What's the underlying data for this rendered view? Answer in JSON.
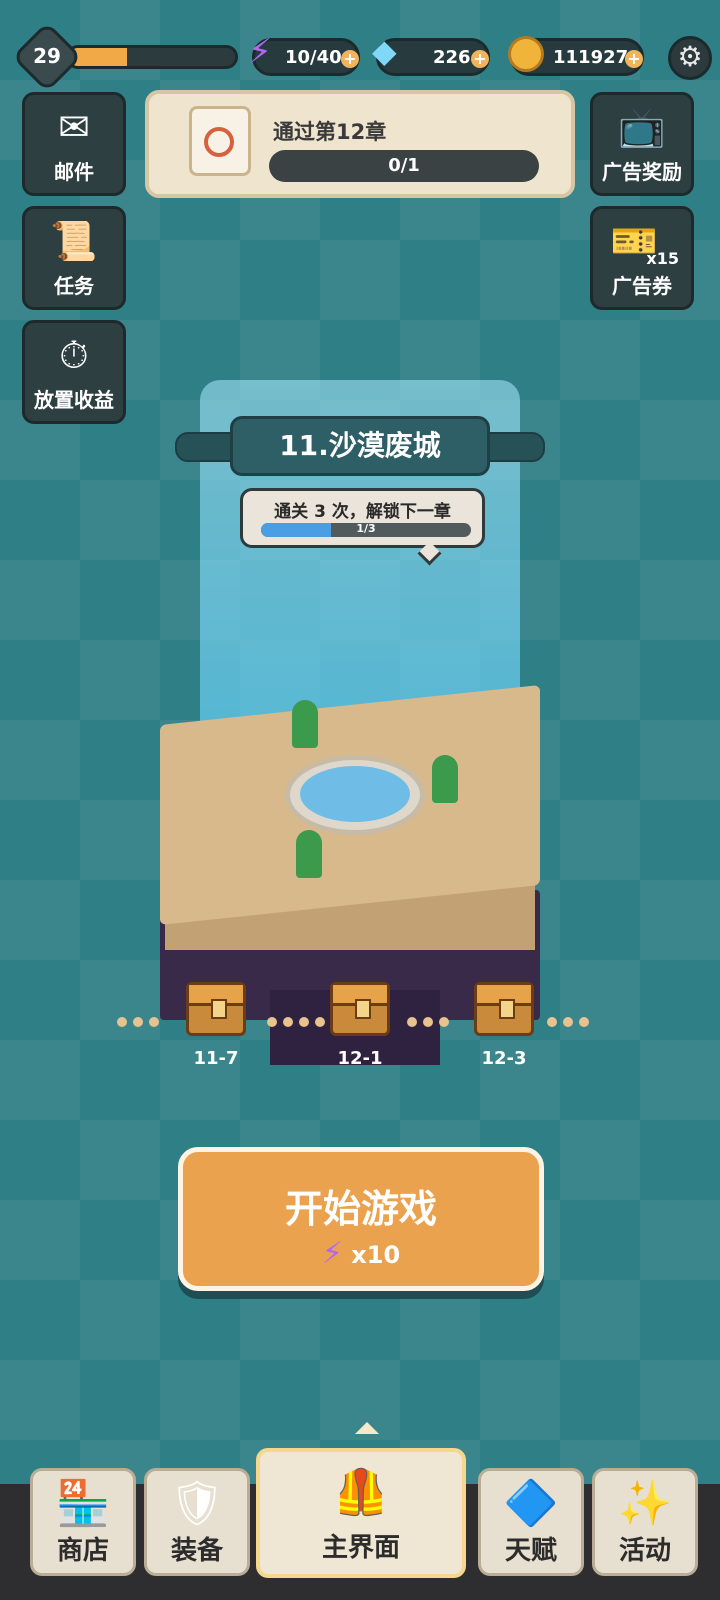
{
  "top_bar": {
    "level": "29",
    "xp_fraction": 0.35,
    "energy": "10/40",
    "gems": "226",
    "coins": "111927",
    "plus": "+",
    "icons": {
      "energy": "lightning-icon",
      "gems": "gem-icon",
      "coins": "coin-stack-icon",
      "settings": "gear-icon"
    }
  },
  "side_left": [
    {
      "label": "邮件",
      "icon": "mail-icon"
    },
    {
      "label": "任务",
      "icon": "scroll-icon"
    },
    {
      "label": "放置收益",
      "icon": "stopwatch-icon"
    }
  ],
  "side_right": [
    {
      "label": "广告奖励",
      "icon": "tv-icon"
    },
    {
      "label": "广告券",
      "icon": "ticket-icon",
      "count": "x15"
    }
  ],
  "mission": {
    "title": "通过第12章",
    "progress_text": "0/1",
    "progress": 0.0
  },
  "chapter": {
    "title": "11.沙漠废城",
    "unlock_text": "通关 3 次，解锁下一章",
    "unlock_progress_text": "1/3",
    "unlock_progress": 0.333
  },
  "stages": [
    {
      "label": "11-7"
    },
    {
      "label": "12-1"
    },
    {
      "label": "12-3"
    }
  ],
  "start": {
    "title": "开始游戏",
    "cost": "x10"
  },
  "nav": [
    {
      "label": "商店",
      "icon": "shop-icon",
      "active": false
    },
    {
      "label": "装备",
      "icon": "sword-shield-icon",
      "active": false
    },
    {
      "label": "主界面",
      "icon": "armor-icon",
      "active": true
    },
    {
      "label": "天赋",
      "icon": "talent-icon",
      "active": false
    },
    {
      "label": "活动",
      "icon": "activity-icon",
      "active": false
    }
  ]
}
